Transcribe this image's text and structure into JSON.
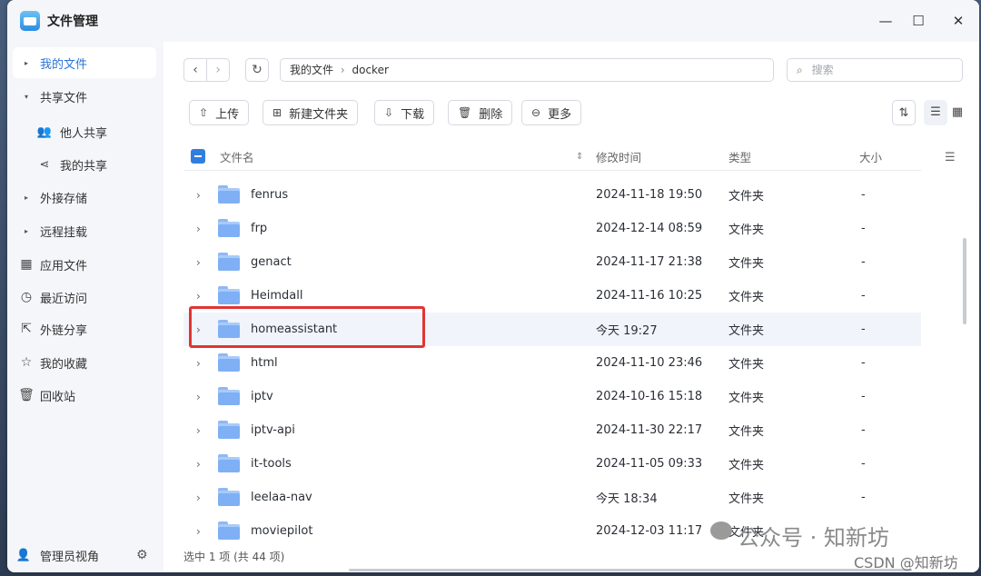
{
  "window": {
    "title": "文件管理"
  },
  "sidebar": {
    "items": [
      {
        "label": "我的文件"
      },
      {
        "label": "共享文件"
      },
      {
        "label": "他人共享"
      },
      {
        "label": "我的共享"
      },
      {
        "label": "外接存储"
      },
      {
        "label": "远程挂载"
      },
      {
        "label": "应用文件"
      },
      {
        "label": "最近访问"
      },
      {
        "label": "外链分享"
      },
      {
        "label": "我的收藏"
      },
      {
        "label": "回收站"
      }
    ],
    "footer_label": "管理员视角"
  },
  "path": {
    "root": "我的文件",
    "sep": "›",
    "current": "docker"
  },
  "search": {
    "placeholder": "搜索"
  },
  "toolbar": {
    "upload": "上传",
    "new_folder": "新建文件夹",
    "download": "下载",
    "delete": "删除",
    "more": "更多"
  },
  "table": {
    "headers": {
      "name": "文件名",
      "modified": "修改时间",
      "type": "类型",
      "size": "大小"
    },
    "rows": [
      {
        "name": "fenrus",
        "time": "2024-11-18 19:50",
        "type": "文件夹",
        "size": "-"
      },
      {
        "name": "frp",
        "time": "2024-12-14 08:59",
        "type": "文件夹",
        "size": "-"
      },
      {
        "name": "genact",
        "time": "2024-11-17 21:38",
        "type": "文件夹",
        "size": "-"
      },
      {
        "name": "Heimdall",
        "time": "2024-11-16 10:25",
        "type": "文件夹",
        "size": "-"
      },
      {
        "name": "homeassistant",
        "time": "今天 19:27",
        "type": "文件夹",
        "size": "-"
      },
      {
        "name": "html",
        "time": "2024-11-10 23:46",
        "type": "文件夹",
        "size": "-"
      },
      {
        "name": "iptv",
        "time": "2024-10-16 15:18",
        "type": "文件夹",
        "size": "-"
      },
      {
        "name": "iptv-api",
        "time": "2024-11-30 22:17",
        "type": "文件夹",
        "size": "-"
      },
      {
        "name": "it-tools",
        "time": "2024-11-05 09:33",
        "type": "文件夹",
        "size": "-"
      },
      {
        "name": "leelaa-nav",
        "time": "今天 18:34",
        "type": "文件夹",
        "size": "-"
      },
      {
        "name": "moviepilot",
        "time": "2024-12-03 11:17",
        "type": "文件夹",
        "size": ""
      }
    ]
  },
  "status": {
    "text": "选中 1 项 (共 44 项)"
  },
  "watermark": {
    "text": "公众号 · 知新坊",
    "csdn": "CSDN @知新坊"
  },
  "colors": {
    "accent": "#2a74d8",
    "highlight_box": "#e23434",
    "folder": "#7fb0f5"
  }
}
